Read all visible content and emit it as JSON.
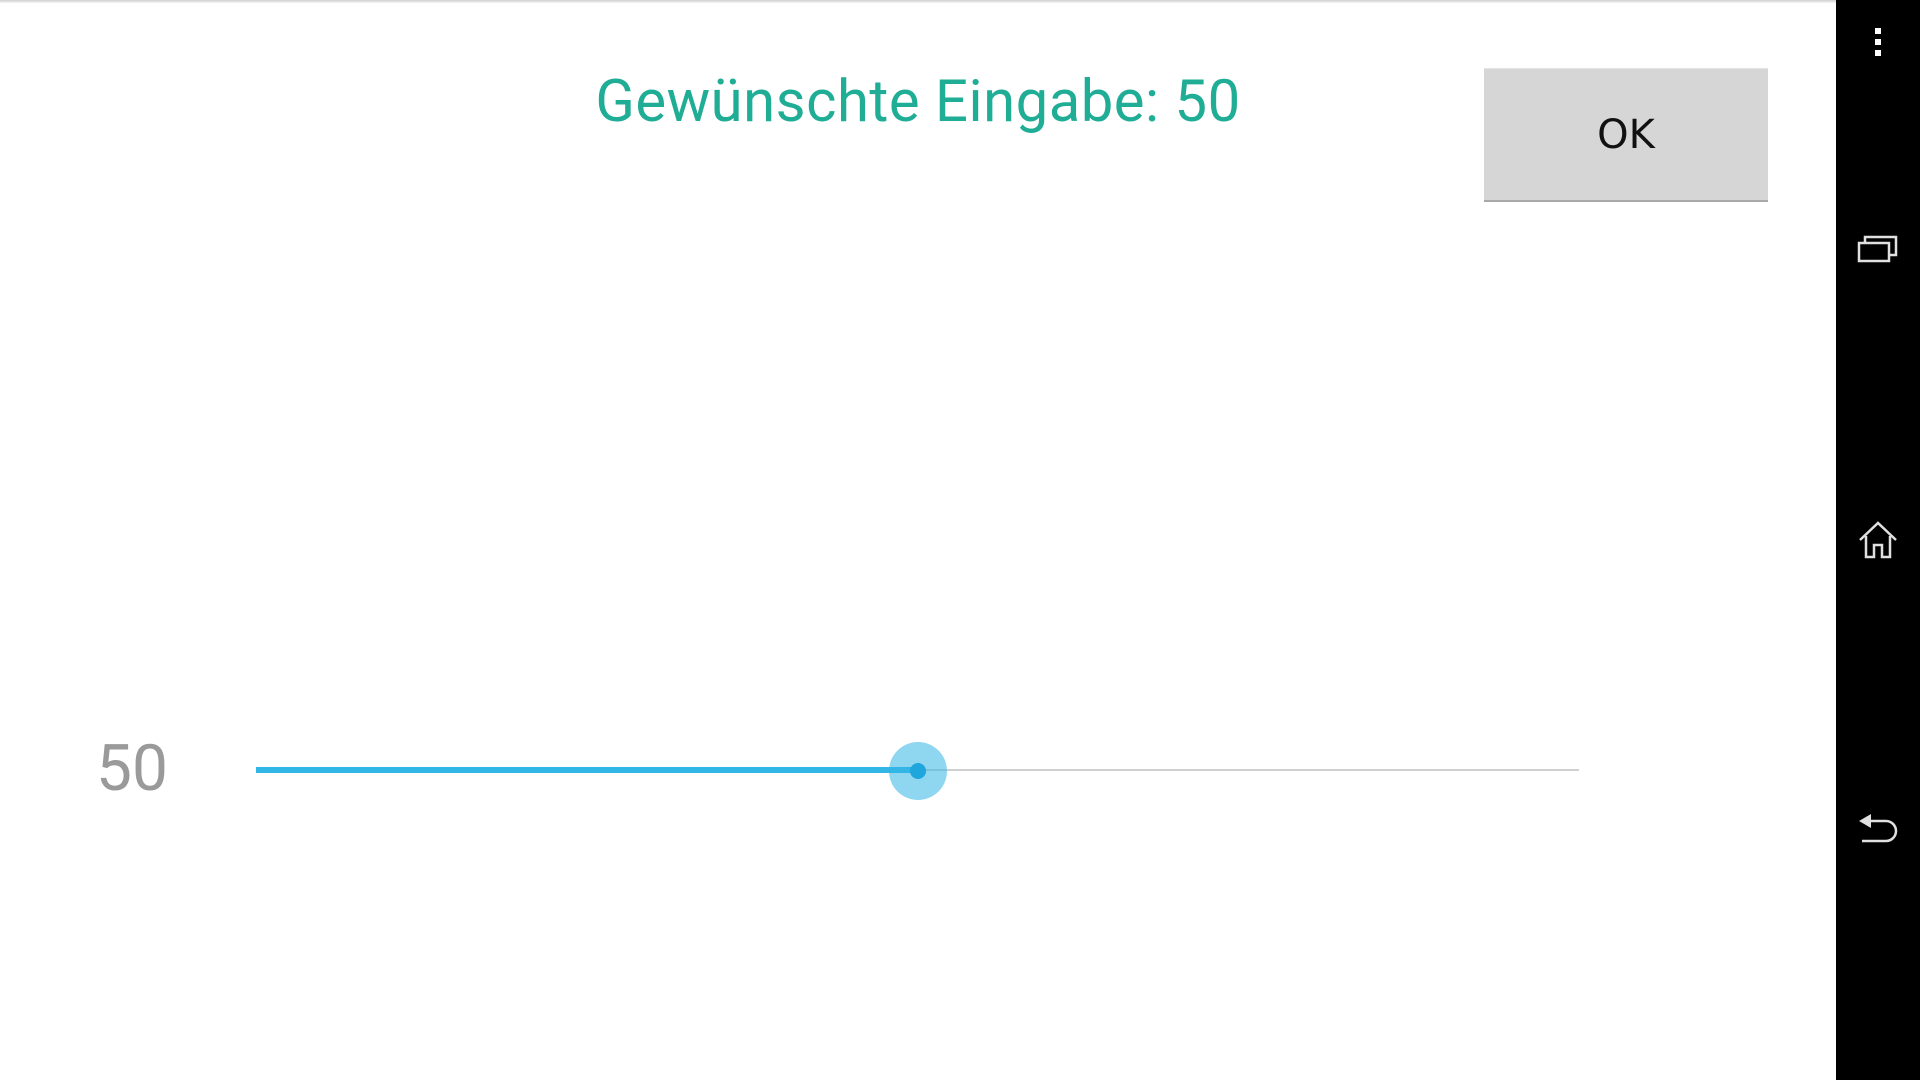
{
  "dialog": {
    "title": "Gewünschte Eingabe: 50",
    "ok_label": "OK"
  },
  "slider": {
    "value_label": "50",
    "value": 50,
    "fraction": 0.5,
    "color_active": "#33b5e5",
    "color_track": "#d0d0d0"
  },
  "colors": {
    "title": "#20ad96",
    "button_bg": "#d6d6d6",
    "navbar_bg": "#000000"
  },
  "navbar": {
    "icons": [
      "more-vert-icon",
      "recent-apps-icon",
      "home-icon",
      "back-icon"
    ]
  }
}
